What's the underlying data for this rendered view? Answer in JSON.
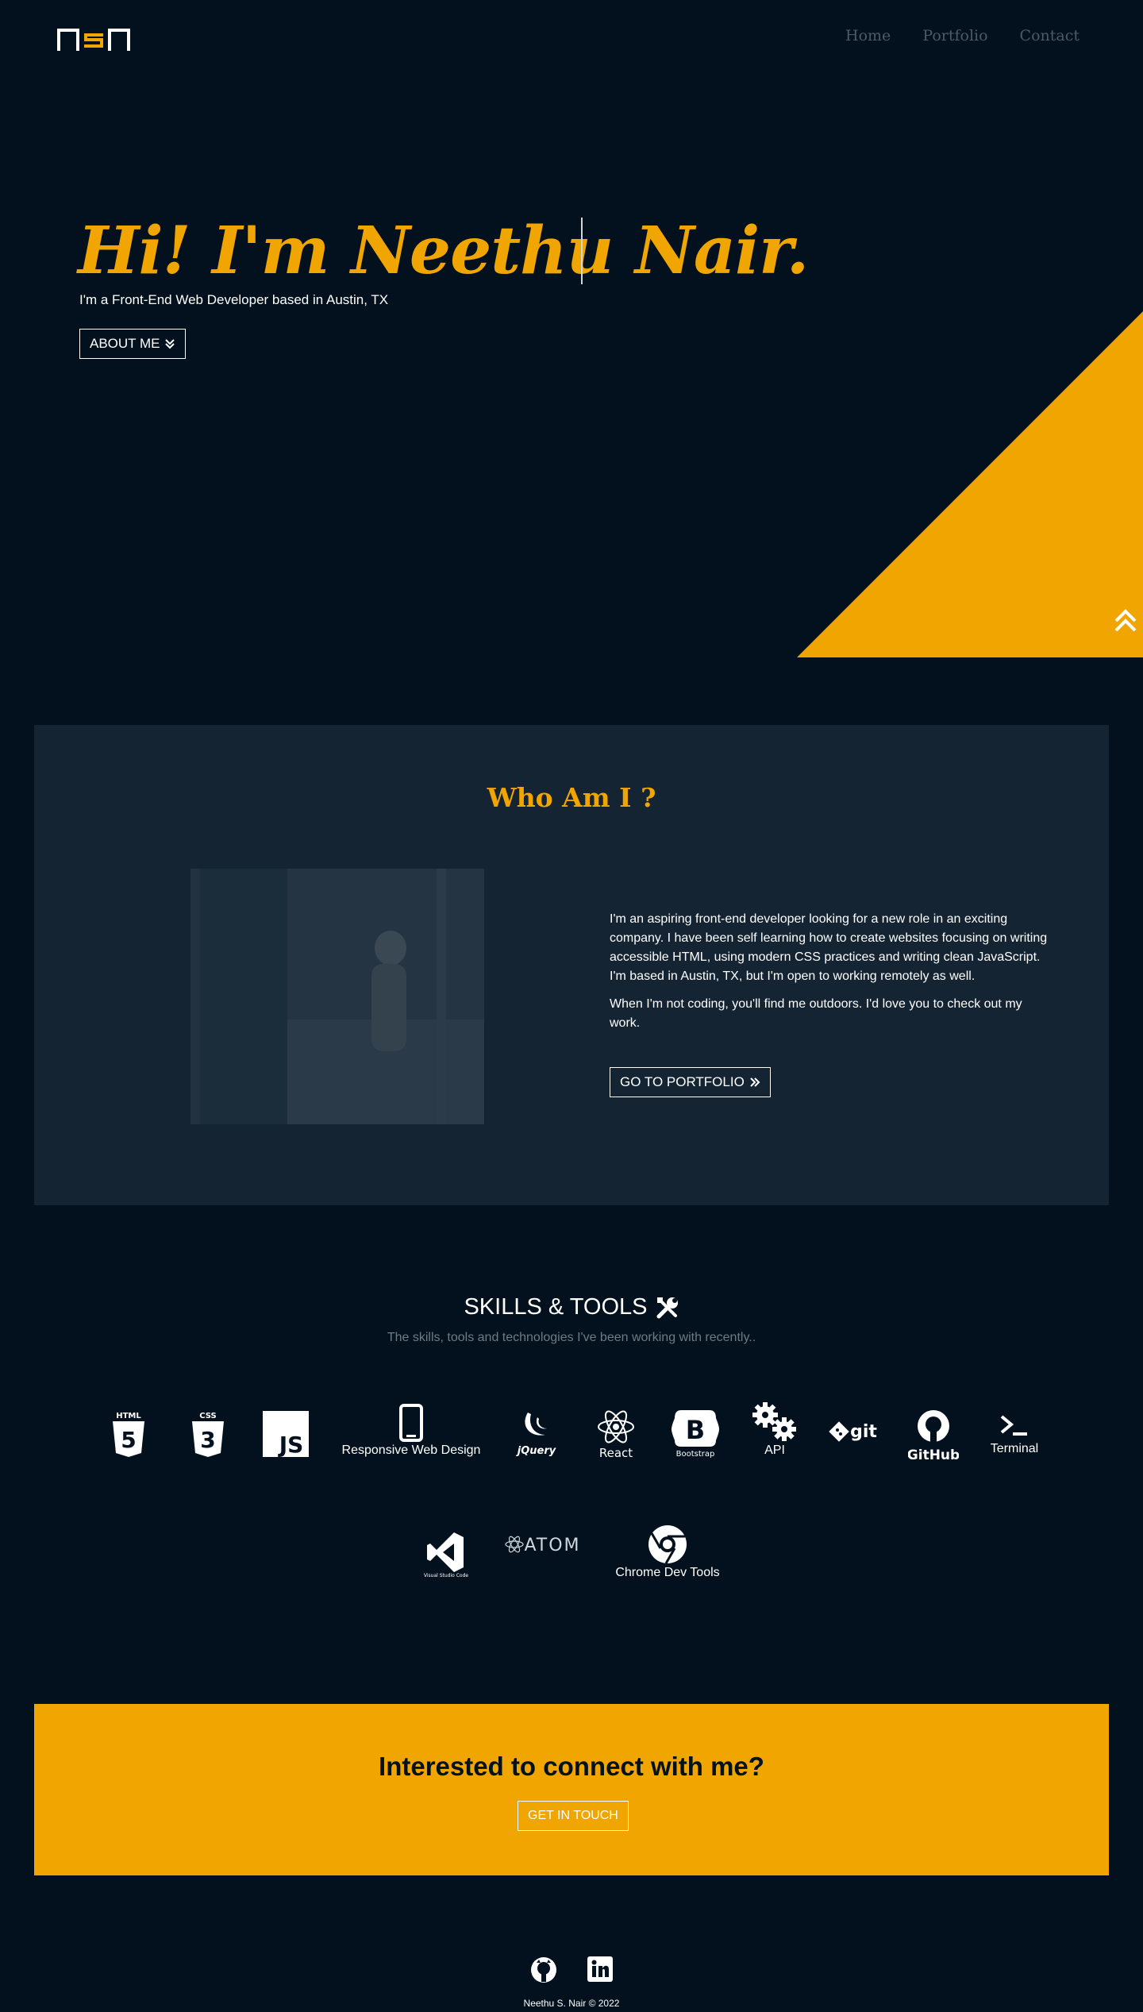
{
  "nav": {
    "logo_text": "nsn",
    "links": [
      {
        "label": "Home"
      },
      {
        "label": "Portfolio"
      },
      {
        "label": "Contact"
      }
    ]
  },
  "hero": {
    "title": "Hi! I'm Neethu Nair.",
    "subtitle": "I'm a Front-End Web Developer based in Austin, TX",
    "about_button": "ABOUT ME"
  },
  "about": {
    "title": "Who Am I ?",
    "paragraphs": [
      "I'm an aspiring front-end developer looking for a new role in an exciting company. I have been self learning how to create websites focusing on writing accessible HTML, using modern CSS practices and writing clean JavaScript. I'm based in Austin, TX, but I'm open to working remotely as well.",
      "When I'm not coding, you'll find me outdoors. I'd love you to check out my work."
    ],
    "portfolio_button": "GO TO PORTFOLIO"
  },
  "skills": {
    "title": "SKILLS & TOOLS",
    "subtitle": "The skills, tools and technologies I've been working with recently..",
    "items": [
      {
        "icon": "html5-icon",
        "label": "HTML"
      },
      {
        "icon": "css3-icon",
        "label": "CSS"
      },
      {
        "icon": "javascript-icon",
        "label": "JS"
      },
      {
        "icon": "mobile-icon",
        "label": "Responsive Web Design"
      },
      {
        "icon": "jquery-icon",
        "label": "jQuery"
      },
      {
        "icon": "react-icon",
        "label": "React"
      },
      {
        "icon": "bootstrap-icon",
        "label": "Bootstrap"
      },
      {
        "icon": "gears-icon",
        "label": "API"
      },
      {
        "icon": "git-icon",
        "label": "git"
      },
      {
        "icon": "github-icon",
        "label": "GitHub"
      },
      {
        "icon": "terminal-icon",
        "label": "Terminal"
      },
      {
        "icon": "vscode-icon",
        "label": "Visual Studio Code"
      },
      {
        "icon": "atom-icon",
        "label": "ATOM"
      },
      {
        "icon": "chrome-icon",
        "label": "Chrome Dev Tools"
      }
    ]
  },
  "cta": {
    "title": "Interested to connect with me?",
    "button": "GET IN TOUCH"
  },
  "footer": {
    "copyright": "Neethu S. Nair © 2022"
  },
  "colors": {
    "background": "#02111d",
    "panel": "#142433",
    "accent": "#f0a500"
  }
}
